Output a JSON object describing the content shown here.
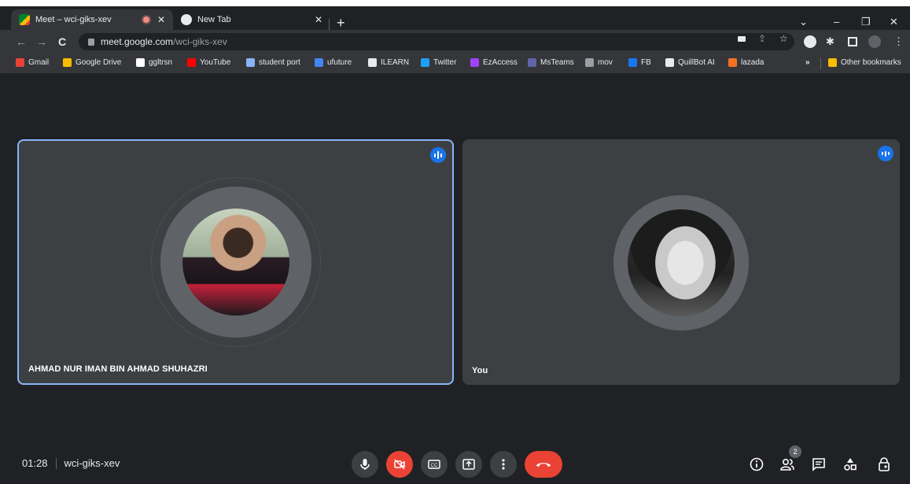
{
  "browser": {
    "tabs": [
      {
        "title": "Meet – wci-giks-xev",
        "active": true
      },
      {
        "title": "New Tab",
        "active": false
      }
    ],
    "url": {
      "host": "meet.google.com",
      "path": "/wci-giks-xev"
    },
    "bookmarks": [
      {
        "label": "Gmail",
        "color": "#ea4335"
      },
      {
        "label": "Google Drive",
        "color": "#fbbc04"
      },
      {
        "label": "ggltrsn",
        "color": "#ffffff"
      },
      {
        "label": "YouTube",
        "color": "#ff0000"
      },
      {
        "label": "student port",
        "color": "#8ab4f8"
      },
      {
        "label": "ufuture",
        "color": "#4285f4"
      },
      {
        "label": "ILEARN",
        "color": "#e8eaed"
      },
      {
        "label": "Twitter",
        "color": "#1da1f2"
      },
      {
        "label": "EzAccess",
        "color": "#a142f4"
      },
      {
        "label": "MsTeams",
        "color": "#6264a7"
      },
      {
        "label": "mov",
        "color": "#9aa0a6"
      },
      {
        "label": "FB",
        "color": "#1877f2"
      },
      {
        "label": "QuillBot AI",
        "color": "#e8eaed"
      },
      {
        "label": "lazada",
        "color": "#f57224"
      }
    ],
    "more_bookmarks": "»",
    "other_bookmarks": "Other bookmarks"
  },
  "meeting": {
    "participants": [
      {
        "name": "AHMAD NUR IMAN BIN AHMAD SHUHAZRI",
        "speaking": true
      },
      {
        "name": "You",
        "speaking": false
      }
    ],
    "time": "01:28",
    "code": "wci-giks-xev",
    "people_count": "2"
  },
  "colors": {
    "background": "#202124",
    "tile": "#3c4043",
    "accent": "#8ab4f8",
    "danger": "#ea4335",
    "speaking": "#1a73e8"
  }
}
